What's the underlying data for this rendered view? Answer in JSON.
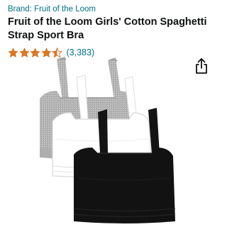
{
  "product": {
    "brand": "Brand: Fruit of the Loom",
    "title": "Fruit of the Loom Girls' Cotton Spaghetti Strap Sport Bra",
    "rating": 4.5,
    "review_count": "(3,383)"
  },
  "colors": {
    "link": "#007185",
    "star": "#de7921",
    "text": "#0f1111"
  },
  "icons": {
    "share": "share-icon",
    "star": "star-icon"
  }
}
